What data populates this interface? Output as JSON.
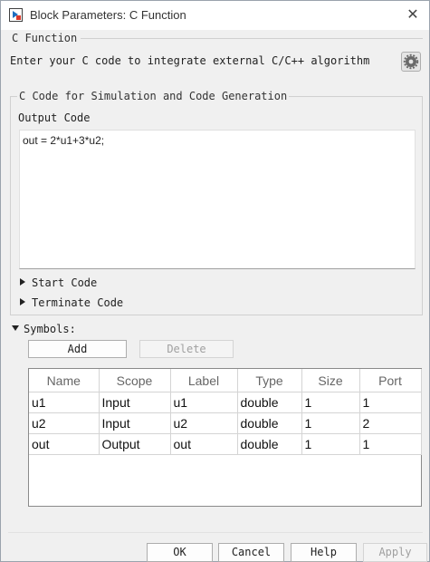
{
  "window": {
    "title": "Block Parameters: C Function"
  },
  "block": {
    "name": "C Function",
    "description": "Enter your C code to integrate external C/C++ algorithm"
  },
  "code_group": {
    "title": "C Code for Simulation and Code Generation",
    "output_label": "Output Code",
    "output_code": "out = 2*u1+3*u2;",
    "start_code_label": "Start Code",
    "terminate_code_label": "Terminate Code"
  },
  "symbols": {
    "label": "Symbols:",
    "add_label": "Add",
    "delete_label": "Delete",
    "columns": [
      "Name",
      "Scope",
      "Label",
      "Type",
      "Size",
      "Port"
    ],
    "rows": [
      [
        "u1",
        "Input",
        "u1",
        "double",
        "1",
        "1"
      ],
      [
        "u2",
        "Input",
        "u2",
        "double",
        "1",
        "2"
      ],
      [
        "out",
        "Output",
        "out",
        "double",
        "1",
        "1"
      ]
    ]
  },
  "footer": {
    "ok_label": "OK",
    "cancel_label": "Cancel",
    "help_label": "Help",
    "apply_label": "Apply"
  },
  "icons": {
    "app": "simulink-block-icon",
    "close": "close-icon",
    "settings": "gear-icon"
  },
  "colors": {
    "window_bg": "#f0f0f0",
    "title_bg": "#ffffff",
    "table_border": "#8a8a8a",
    "disabled_text": "#a0a0a0"
  }
}
